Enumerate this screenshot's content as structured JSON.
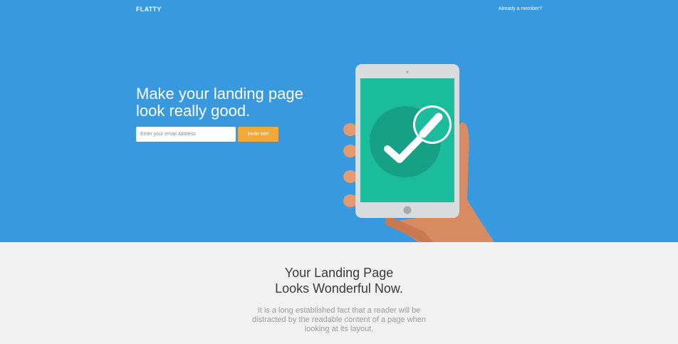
{
  "nav": {
    "brand": "FLATTY",
    "member_link": "Already a member?"
  },
  "hero": {
    "headline_line1": "Make your landing page",
    "headline_line2": "look really good.",
    "email_placeholder": "Enter your email address",
    "invite_label": "Invite Me!",
    "illustration_icon": "hand-holding-tablet-checkmark-icon"
  },
  "feature": {
    "title_line1": "Your Landing Page",
    "title_line2": "Looks Wonderful Now.",
    "text_line1": "It is a long established fact that a reader will be",
    "text_line2": "distracted by the readable content of a page when",
    "text_line3": "looking at its layout."
  },
  "colors": {
    "hero_bg": "#3899df",
    "button": "#f0a93a",
    "screen": "#1bbc9b",
    "section_bg": "#f1f1f1"
  }
}
